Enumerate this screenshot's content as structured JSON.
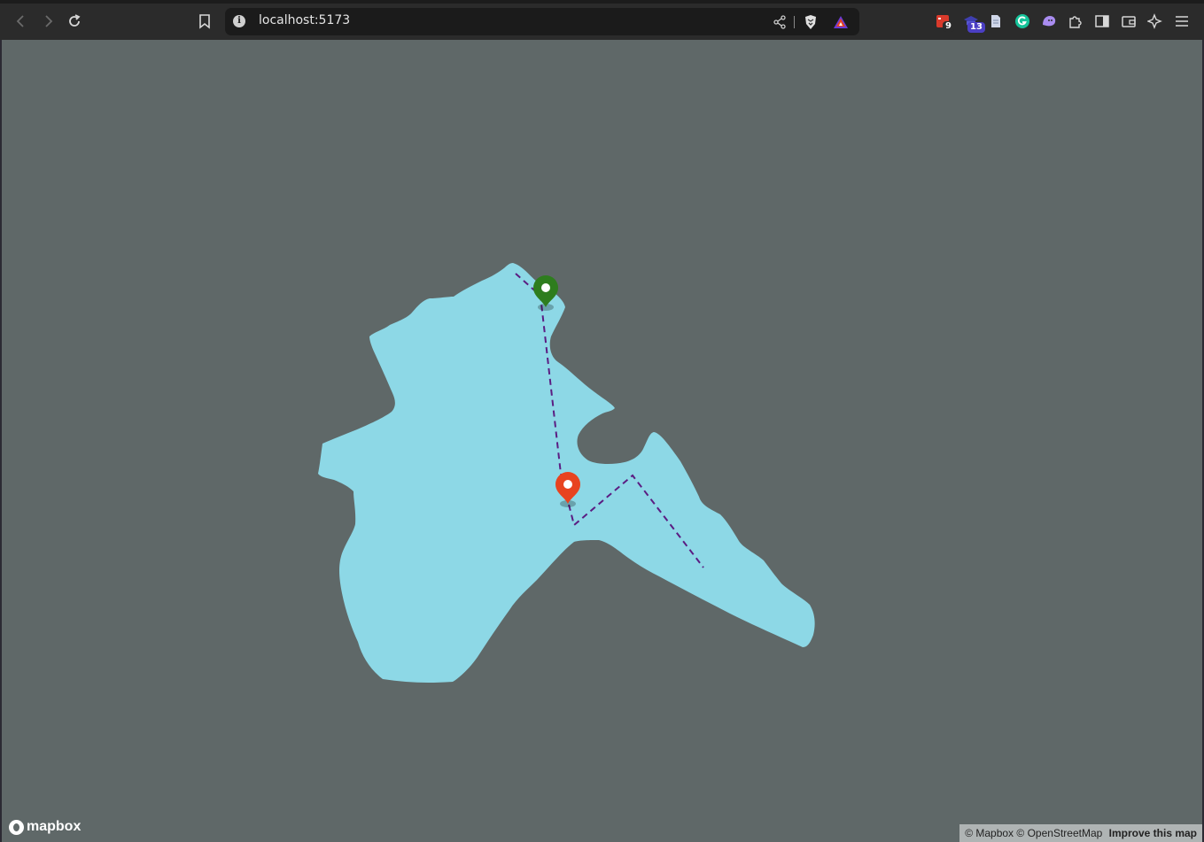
{
  "browser": {
    "url": "localhost:5173",
    "badges": {
      "ext1": "9",
      "ext2": "13"
    }
  },
  "map": {
    "background_color": "#5f6868",
    "polygon_fill": "#8dd8e6",
    "route_color": "#5b1d82",
    "markers": [
      {
        "name": "start-marker",
        "color": "#2e7d1e"
      },
      {
        "name": "end-marker",
        "color": "#e8431f"
      }
    ],
    "logo_text": "mapbox",
    "attribution": {
      "mapbox": "© Mapbox",
      "osm": "© OpenStreetMap",
      "improve": "Improve this map"
    }
  }
}
